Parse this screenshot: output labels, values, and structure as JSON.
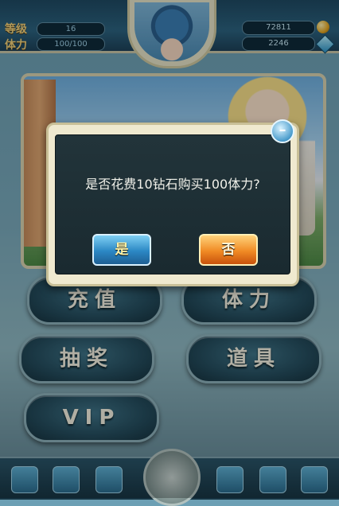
{
  "header": {
    "level_label": "等级",
    "level_value": "16",
    "stamina_label": "体力",
    "stamina_value": "100/100",
    "gold_value": "72811",
    "gems_value": "2246"
  },
  "menu": {
    "recharge": "充值",
    "stamina": "体力",
    "lottery": "抽奖",
    "items": "道具",
    "vip": "VIP"
  },
  "dialog": {
    "message": "是否花费10钻石购买100体力?",
    "yes_label": "是",
    "no_label": "否",
    "close_glyph": "–"
  },
  "icons": {
    "gold": "coin-icon",
    "gems": "diamond-icon"
  },
  "colors": {
    "yes_button": "#2b87c4",
    "no_button": "#f08a24",
    "label_gold": "#f3d27a"
  }
}
